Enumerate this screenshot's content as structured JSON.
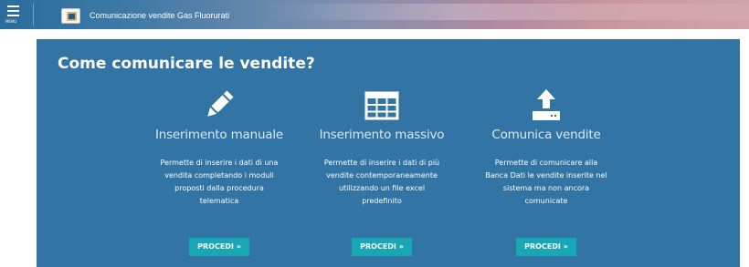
{
  "header": {
    "menu_label": "MENU",
    "app_title": "Comunicazione vendite Gas Fluorurati"
  },
  "main": {
    "title": "Come comunicare le vendite?",
    "cards": [
      {
        "icon": "pencil-icon",
        "title": "Inserimento manuale",
        "description_lines": [
          "Permette di inserire i dati di una",
          "vendita completando i moduli",
          "proposti dalla procedura",
          "telematica"
        ],
        "button": "PROCEDI »"
      },
      {
        "icon": "table-grid-icon",
        "title": "Inserimento massivo",
        "description_lines": [
          "Permette di inserire i dati di più",
          "vendite contemporaneamente",
          "utilizzando un file excel",
          "predefinito"
        ],
        "button": "PROCEDI »"
      },
      {
        "icon": "upload-icon",
        "title": "Comunica vendite",
        "description_lines": [
          "Permette di comunicare alla",
          "Banca Dati le vendite inserite nel",
          "sistema ma non ancora",
          "comunicate"
        ],
        "button": "PROCEDI »"
      }
    ]
  },
  "colors": {
    "panel_bg": "#3274a3",
    "button_bg": "#18a7b5",
    "text": "#ffffff"
  }
}
